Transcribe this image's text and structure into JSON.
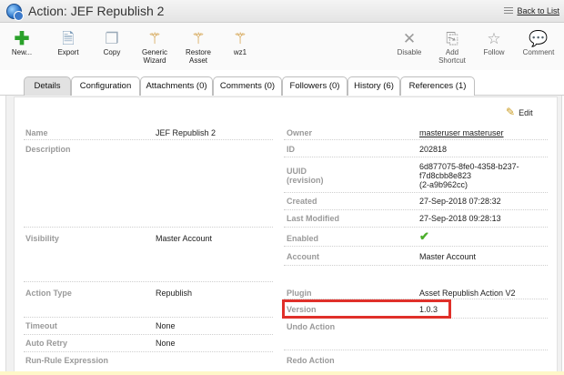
{
  "title": "Action: JEF Republish 2",
  "back_label": "Back to List",
  "toolbar": {
    "new": "New...",
    "export": "Export",
    "copy": "Copy",
    "generic_wizard": [
      "Generic",
      "Wizard"
    ],
    "restore_asset": [
      "Restore",
      "Asset"
    ],
    "wz1": "wz1",
    "disable": "Disable",
    "add_shortcut": [
      "Add",
      "Shortcut"
    ],
    "follow": "Follow",
    "comment": "Comment"
  },
  "tabs": [
    {
      "label": "Details"
    },
    {
      "label": "Configuration"
    },
    {
      "label": "Attachments (0)"
    },
    {
      "label": "Comments (0)"
    },
    {
      "label": "Followers (0)"
    },
    {
      "label": "History (6)"
    },
    {
      "label": "References (1)"
    }
  ],
  "edit_label": "Edit",
  "left_fields": {
    "name": {
      "label": "Name",
      "value": "JEF Republish 2"
    },
    "description": {
      "label": "Description",
      "value": ""
    },
    "visibility": {
      "label": "Visibility",
      "value": "Master Account"
    },
    "action_type": {
      "label": "Action Type",
      "value": "Republish"
    },
    "timeout": {
      "label": "Timeout",
      "value": "None"
    },
    "auto_retry": {
      "label": "Auto Retry",
      "value": "None"
    },
    "run_rule": {
      "label": "Run-Rule Expression",
      "value": ""
    }
  },
  "right_fields": {
    "owner": {
      "label": "Owner",
      "value": "masteruser masteruser"
    },
    "id": {
      "label": "ID",
      "value": "202818"
    },
    "uuid": {
      "label": "UUID",
      "label2": "(revision)",
      "value": "6d877075-8fe0-4358-b237-f7d8cbb8e823",
      "value2": "(2-a9b962cc)"
    },
    "created": {
      "label": "Created",
      "value": "27-Sep-2018 07:28:32"
    },
    "last_modified": {
      "label": "Last Modified",
      "value": "27-Sep-2018 09:28:13"
    },
    "enabled": {
      "label": "Enabled"
    },
    "account": {
      "label": "Account",
      "value": "Master Account"
    },
    "plugin": {
      "label": "Plugin",
      "value": "Asset Republish Action V2"
    },
    "version": {
      "label": "Version",
      "value": "1.0.3"
    },
    "undo_action": {
      "label": "Undo Action",
      "value": ""
    },
    "redo_action": {
      "label": "Redo Action",
      "value": ""
    }
  }
}
